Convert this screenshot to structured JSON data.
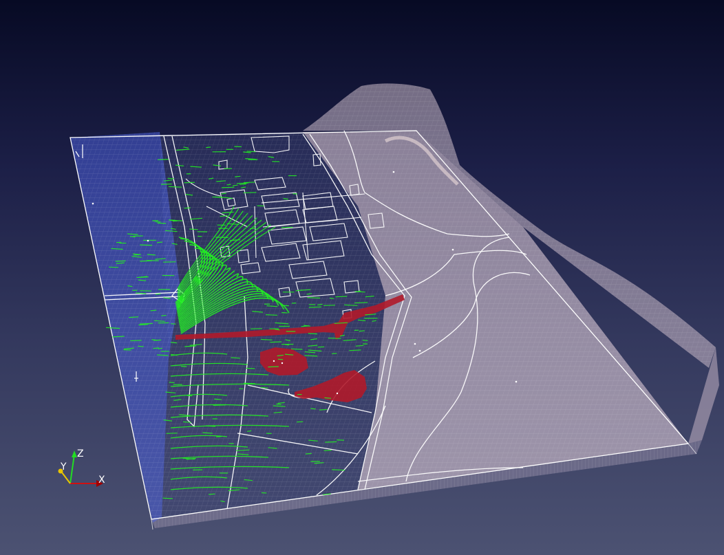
{
  "viewer": {
    "background_top": "#070a24",
    "background_bottom": "#4c5272"
  },
  "scene": {
    "description_icon": "3d-groundwater-model",
    "colors": {
      "terrain_fill": "#d9c8d2",
      "water_fill": "#4a5ed8",
      "outline": "#ffffff",
      "flow_lines": "#22ee22",
      "plume": "#b01a2a",
      "grid": "#ffffff"
    }
  },
  "orientation_axes": {
    "x_label": "X",
    "y_label": "Y",
    "z_label": "Z",
    "x_color": "#d01010",
    "y_color": "#e8c400",
    "z_color": "#22dd22"
  }
}
